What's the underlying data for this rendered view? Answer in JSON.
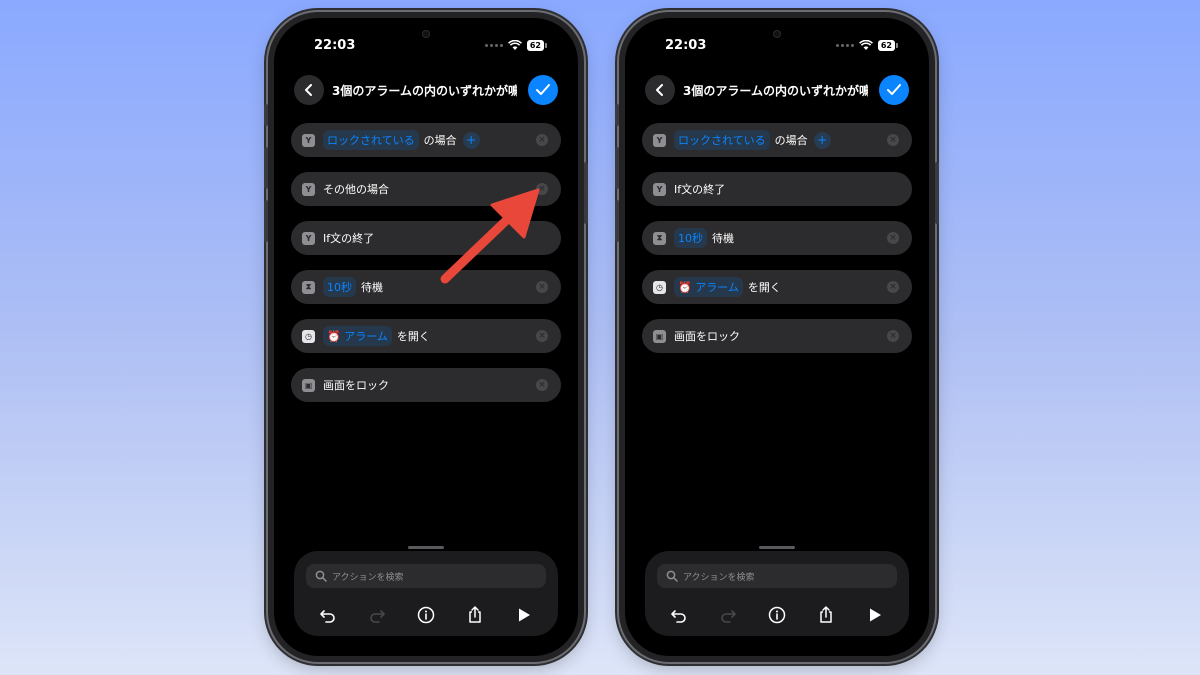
{
  "phones": [
    {
      "status": {
        "time": "22:03",
        "battery": "62"
      },
      "nav": {
        "title": "3個のアラームの内のいずれかが鳴…"
      },
      "rows": [
        {
          "token": "ロックされている",
          "label": "の場合"
        },
        {
          "label": "その他の場合"
        },
        {
          "label": "If文の終了"
        },
        {
          "token": "10秒",
          "label": "待機"
        },
        {
          "token": "アラーム",
          "label": "を開く"
        },
        {
          "label": "画面をロック"
        }
      ],
      "search": {
        "placeholder": "アクションを検索"
      }
    },
    {
      "status": {
        "time": "22:03",
        "battery": "62"
      },
      "nav": {
        "title": "3個のアラームの内のいずれかが鳴…"
      },
      "rows": [
        {
          "token": "ロックされている",
          "label": "の場合"
        },
        {
          "label": "If文の終了"
        },
        {
          "token": "10秒",
          "label": "待機"
        },
        {
          "token": "アラーム",
          "label": "を開く"
        },
        {
          "label": "画面をロック"
        }
      ],
      "search": {
        "placeholder": "アクションを検索"
      }
    }
  ],
  "icons": {
    "if": "branch-icon",
    "wait": "hourglass-icon",
    "alarm": "clock-icon",
    "lock": "lock-icon",
    "remove": "remove-circle-icon",
    "annotation": "red-arrow-icon"
  },
  "colors": {
    "accent": "#0a84ff",
    "annotation_arrow": "#e8473a",
    "background_top": "#8aa9ff",
    "background_bottom": "#dde5f8"
  }
}
